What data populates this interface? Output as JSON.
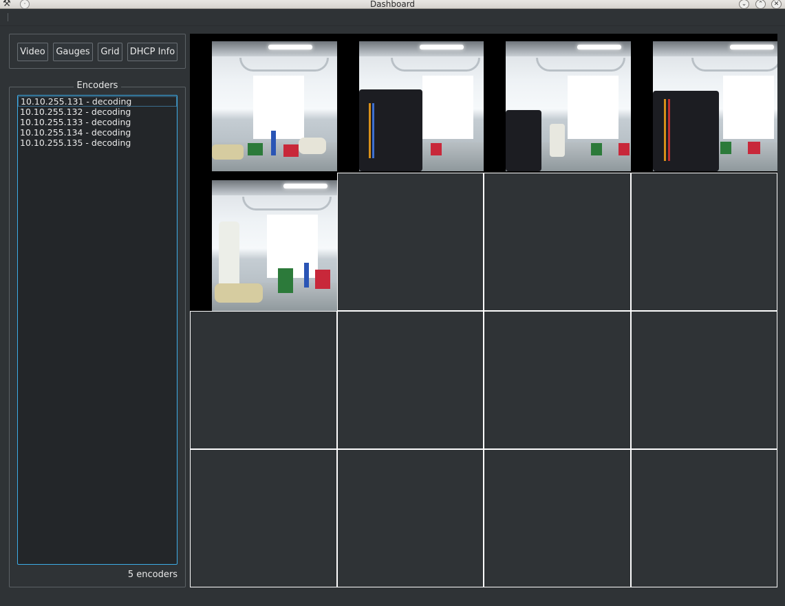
{
  "window": {
    "title": "Dashboard",
    "app_icon": "tools-icon",
    "buttons": [
      "chevron-down-icon",
      "chevron-up-icon",
      "close-icon"
    ]
  },
  "toolbar": {
    "video_label": "Video",
    "gauges_label": "Gauges",
    "grid_label": "Grid",
    "dhcp_label": "DHCP Info"
  },
  "encoders": {
    "title": "Encoders",
    "items": [
      "10.10.255.131 - decoding",
      "10.10.255.132 - decoding",
      "10.10.255.133 - decoding",
      "10.10.255.134 - decoding",
      "10.10.255.135 - decoding"
    ],
    "count_label": "5 encoders"
  },
  "video_grid": {
    "columns": 4,
    "rows": 4,
    "active_feeds": 5
  },
  "colors": {
    "background": "#2f3336",
    "list_background": "#232629",
    "focus_border": "#3daee9",
    "cell_border": "#ffffff"
  }
}
